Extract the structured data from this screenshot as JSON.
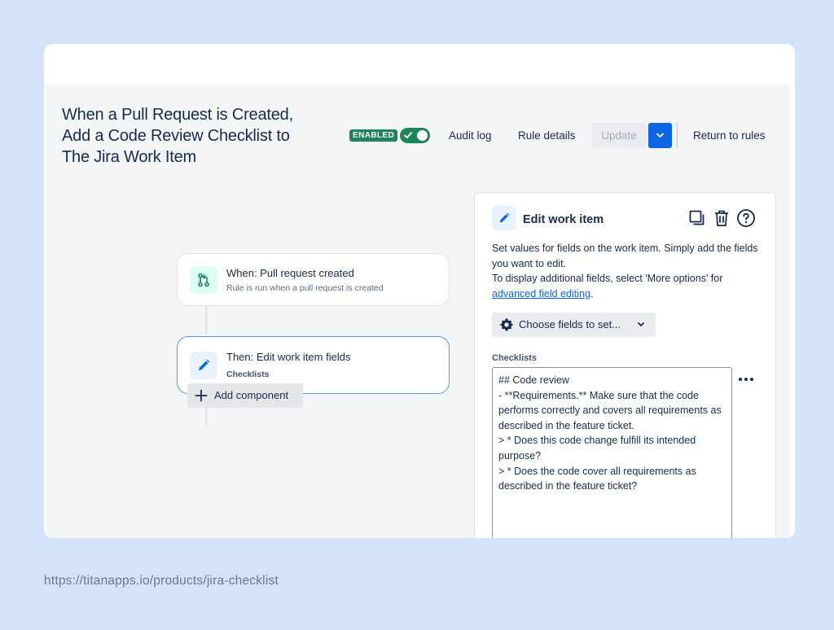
{
  "rule": {
    "title_lines": [
      "When a Pull Request is Created,",
      "Add a Code Review Checklist to",
      "The Jira Work Item"
    ],
    "status_badge": "ENABLED"
  },
  "toolbar": {
    "audit_log": "Audit log",
    "rule_details": "Rule details",
    "update": "Update",
    "return_to_rules": "Return to rules"
  },
  "flow": {
    "trigger": {
      "title": "When: Pull request created",
      "subtitle": "Rule is run when a pull request is created",
      "icon": "git-branch-icon"
    },
    "action": {
      "title": "Then: Edit work item fields",
      "subtitle": "Checklists",
      "icon": "pencil-icon"
    },
    "add_component": "Add component"
  },
  "panel": {
    "title": "Edit work item",
    "description_line1": "Set values for fields on the work item. Simply add the fields you want to edit.",
    "description_line2": "To display additional fields, select 'More options' for",
    "description_link": "advanced field editing",
    "description_end": ".",
    "choose_fields": "Choose fields to set...",
    "field_label": "Checklists",
    "checklist_lines": [
      "## Code review",
      "- **Requirements.** Make sure that the code performs correctly and covers all requirements as described in the feature ticket.",
      "> * Does this code change fulfill its intended purpose?",
      "> * Does the code cover all requirements as described in the feature ticket?"
    ]
  },
  "footer": {
    "url": "https://titanapps.io/products/jira-checklist"
  },
  "colors": {
    "page_bg": "#d4e3fa",
    "enabled_green": "#1f845a",
    "primary_blue": "#0c66e4",
    "selected_border": "#4c9aff"
  }
}
